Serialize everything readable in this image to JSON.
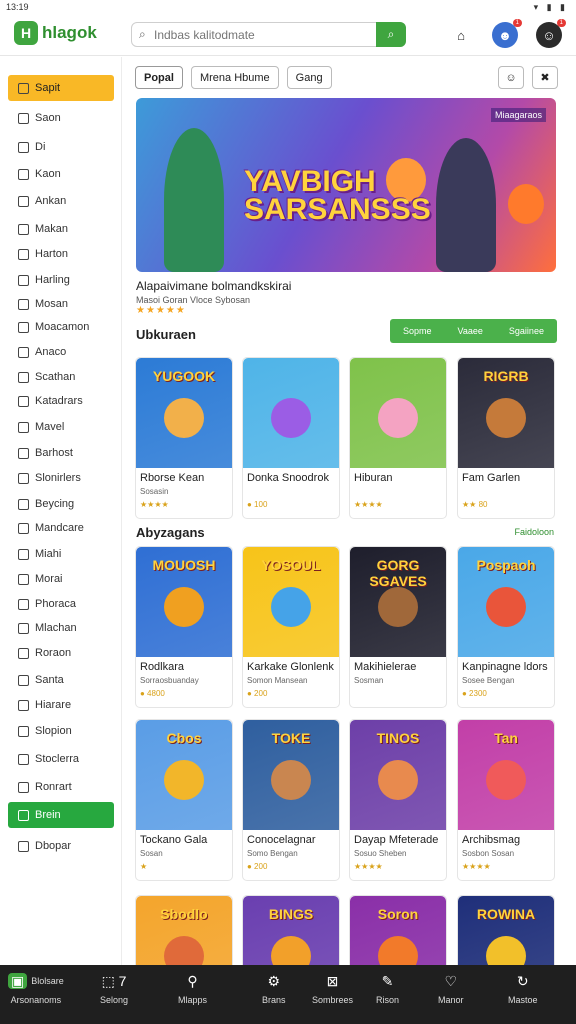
{
  "status": {
    "time": "13:19",
    "signal": "▾ ▮ ▮"
  },
  "app": {
    "name": "hlagok",
    "logo_letter": "H"
  },
  "search": {
    "placeholder": "Indbas kalitodmate"
  },
  "top_icons": [
    {
      "name": "controller-icon",
      "glyph": "⌂",
      "badge": ""
    },
    {
      "name": "avatar-icon",
      "glyph": "☻",
      "badge": "1"
    },
    {
      "name": "profile-icon",
      "glyph": "☺",
      "badge": "1"
    }
  ],
  "sidebar": {
    "items": [
      {
        "label": "Sapit",
        "state": "active"
      },
      {
        "label": "Saon",
        "state": ""
      },
      {
        "label": "Di",
        "state": ""
      },
      {
        "label": "Kaon",
        "state": ""
      },
      {
        "label": "Ankan",
        "state": ""
      },
      {
        "label": "Makan",
        "state": ""
      },
      {
        "label": "Harton",
        "state": ""
      },
      {
        "label": "Harling",
        "state": ""
      },
      {
        "label": "Mosan",
        "state": ""
      },
      {
        "label": "Moacamon",
        "state": ""
      },
      {
        "label": "Anaco",
        "state": ""
      },
      {
        "label": "Scathan",
        "state": ""
      },
      {
        "label": "Katadrars",
        "state": ""
      },
      {
        "label": "Mavel",
        "state": ""
      },
      {
        "label": "Barhost",
        "state": ""
      },
      {
        "label": "Slonirlers",
        "state": ""
      },
      {
        "label": "Beycing",
        "state": ""
      },
      {
        "label": "Mandcare",
        "state": ""
      },
      {
        "label": "Miahi",
        "state": ""
      },
      {
        "label": "Morai",
        "state": ""
      },
      {
        "label": "Phoraca",
        "state": ""
      },
      {
        "label": "Mlachan",
        "state": ""
      },
      {
        "label": "Roraon",
        "state": ""
      },
      {
        "label": "Santa",
        "state": ""
      },
      {
        "label": "Hiarare",
        "state": ""
      },
      {
        "label": "Slopion",
        "state": ""
      },
      {
        "label": "Stoclerra",
        "state": ""
      },
      {
        "label": "Ronrart",
        "state": ""
      },
      {
        "label": "Brein",
        "state": "green"
      },
      {
        "label": "Dbopar",
        "state": ""
      }
    ]
  },
  "filters": {
    "chips": [
      "Popal",
      "Mrena Hbume",
      "Gang"
    ]
  },
  "hero": {
    "title_line1": "YAVBIGH",
    "title_line2": "SARSANSSS",
    "tag": "Miaagaraos",
    "caption": "Alapaivimane bolmandkskirai",
    "sub": "Masoi Goran Vloce Sybosan",
    "stars": "★★★★★"
  },
  "section1": {
    "title": "Ubkuraen",
    "segments": [
      "Sopme",
      "Vaaee",
      "Sgaiinee"
    ]
  },
  "section2": {
    "title": "Abyzagans",
    "see_all": "Faidoloon"
  },
  "row1": [
    {
      "name": "Rborse Kean",
      "sub": "Sosasin",
      "rating": "★★★★",
      "word": "YUGOOK",
      "bg": "#2c7bd6",
      "face": "#f2b04a"
    },
    {
      "name": "Donka Snoodrok",
      "sub": "",
      "rating": "● 100",
      "word": "",
      "bg": "#4fb4e8",
      "face": "#9b5de5"
    },
    {
      "name": "Hiburan",
      "sub": "",
      "rating": "★★★★",
      "word": "",
      "bg": "#7fc24a",
      "face": "#f4a3c2"
    },
    {
      "name": "Fam Garlen",
      "sub": "",
      "rating": "★★ 80",
      "word": "RIGRB",
      "bg": "#2b2b3a",
      "face": "#c57a3a"
    }
  ],
  "row2": [
    {
      "name": "Rodlkara",
      "sub": "Sorraosbuanday",
      "rating": "● 4800",
      "word": "MOUOSH",
      "bg": "#2f6fd4",
      "face": "#f0a020"
    },
    {
      "name": "Karkake Glonlenk",
      "sub": "Somon Mansean",
      "rating": "● 200",
      "word": "YOSOUL",
      "bg": "#f7c419",
      "face": "#45a3e8"
    },
    {
      "name": "Makihielerae",
      "sub": "Sosman",
      "rating": "",
      "word": "GORG SGAVES",
      "bg": "#1e1e2c",
      "face": "#a0683a"
    },
    {
      "name": "Kanpinagne ldors",
      "sub": "Sosee Bengan",
      "rating": "● 2300",
      "word": "Pospaoh",
      "bg": "#4aa8e8",
      "face": "#e9553a"
    }
  ],
  "row3": [
    {
      "name": "Tockano Gala",
      "sub": "Sosan",
      "rating": "★",
      "word": "Cbos",
      "bg": "#5a9de6",
      "face": "#f2b62a"
    },
    {
      "name": "Conocelagnar",
      "sub": "Somo Bengan",
      "rating": "● 200",
      "word": "TOKE",
      "bg": "#2f5f9f",
      "face": "#c98650"
    },
    {
      "name": "Dayap Mfeterade",
      "sub": "Sosuo Sheben",
      "rating": "★★★★",
      "word": "TINOS",
      "bg": "#6d3fa8",
      "face": "#e88a4e"
    },
    {
      "name": "Archibsmag",
      "sub": "Sosbon Sosan",
      "rating": "★★★★",
      "word": "Tan",
      "bg": "#c23fa8",
      "face": "#f05a5a"
    }
  ],
  "row4": [
    {
      "word": "Sbodlo",
      "bg": "#f4a52c",
      "face": "#e06a3a"
    },
    {
      "word": "BINGS",
      "bg": "#6a3fb0",
      "face": "#f2a02a"
    },
    {
      "word": "Soron",
      "bg": "#8a2fa8",
      "face": "#f27a2a"
    },
    {
      "word": "ROWINA",
      "bg": "#1f2f7a",
      "face": "#f2c02a"
    }
  ],
  "bottom_nav": [
    {
      "label": "Blolsare",
      "sub": "Arsonanoms",
      "icon": "▣"
    },
    {
      "label": "Selong",
      "icon": "⬚ 7"
    },
    {
      "label": "Mlapps",
      "icon": "⚲"
    },
    {
      "label": "Brans",
      "icon": "⚙"
    },
    {
      "label": "Sombrees",
      "icon": "⊠"
    },
    {
      "label": "Rison",
      "icon": "✎"
    },
    {
      "label": "Manor",
      "icon": "♡"
    },
    {
      "label": "Mastoe",
      "icon": "↻"
    }
  ]
}
